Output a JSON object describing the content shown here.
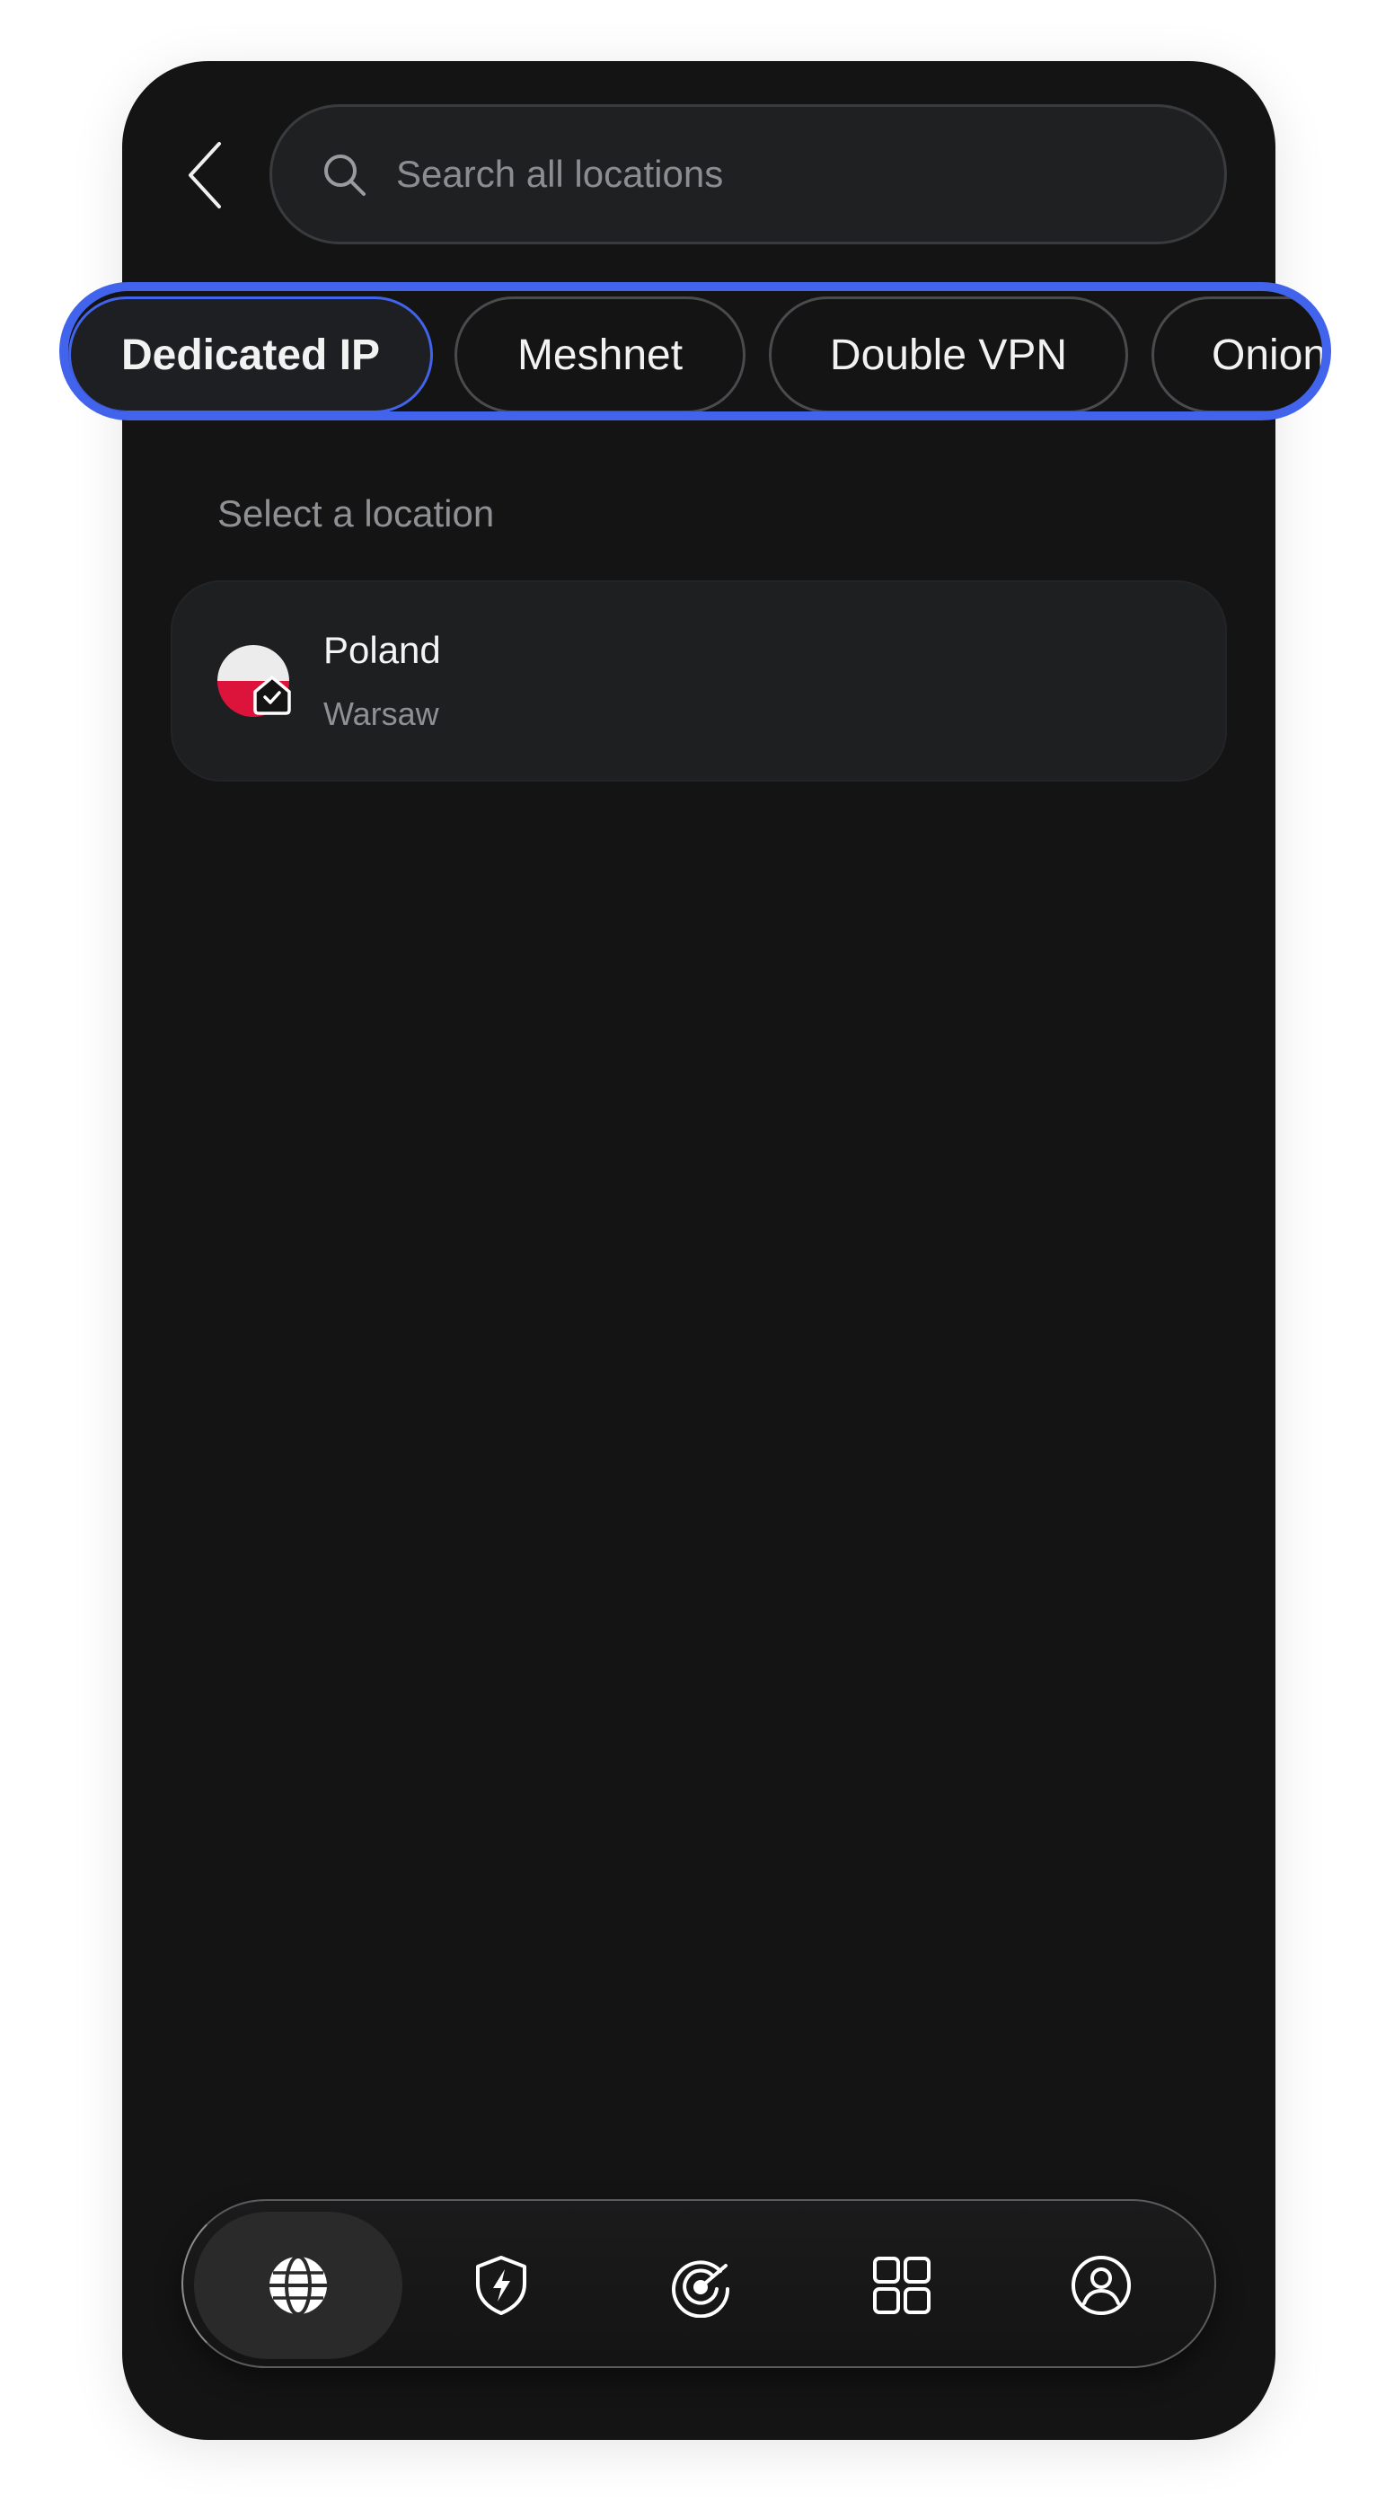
{
  "search": {
    "placeholder": "Search all locations"
  },
  "chips": [
    {
      "label": "Dedicated IP",
      "active": true
    },
    {
      "label": "Meshnet",
      "active": false
    },
    {
      "label": "Double VPN",
      "active": false
    },
    {
      "label": "Onion",
      "active": false
    }
  ],
  "section": {
    "label": "Select a location"
  },
  "location": {
    "country": "Poland",
    "city": "Warsaw",
    "flag_colors": [
      "#ececec",
      "#dc143c"
    ]
  },
  "nav": {
    "items": [
      {
        "icon": "globe-icon",
        "active": true
      },
      {
        "icon": "shield-bolt-icon",
        "active": false
      },
      {
        "icon": "radar-icon",
        "active": false
      },
      {
        "icon": "grid-icon",
        "active": false
      },
      {
        "icon": "profile-icon",
        "active": false
      }
    ]
  },
  "colors": {
    "accent": "#4263eb",
    "background": "#141414",
    "card": "#1e1f21"
  }
}
